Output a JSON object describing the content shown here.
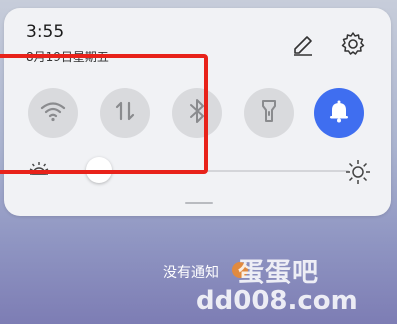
{
  "status": {
    "time": "3:55",
    "date": "8月19日星期五"
  },
  "toolbar": {
    "edit_icon": "pencil-icon",
    "settings_icon": "gear-icon"
  },
  "quick_tiles": [
    {
      "name": "wifi",
      "icon": "wifi-icon",
      "active": false
    },
    {
      "name": "mobile-data",
      "icon": "data-arrows-icon",
      "active": false
    },
    {
      "name": "bluetooth",
      "icon": "bluetooth-icon",
      "active": false
    },
    {
      "name": "flashlight",
      "icon": "flashlight-icon",
      "active": false
    },
    {
      "name": "notification-bell",
      "icon": "bell-icon",
      "active": true
    }
  ],
  "brightness": {
    "level": 0.05
  },
  "notifications": {
    "empty_text": "没有通知"
  },
  "watermark": {
    "brand": "蛋蛋吧",
    "url": "dd008.com"
  },
  "colors": {
    "accent": "#3f6ef0",
    "highlight": "#e8221a",
    "panel": "#f1f2f5"
  }
}
